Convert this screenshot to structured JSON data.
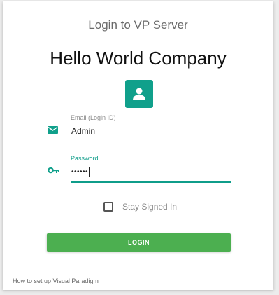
{
  "colors": {
    "accent": "#0f9d8a",
    "login_button": "#4caf50",
    "icon_teal": "#10a08b"
  },
  "header": {
    "title": "Login to VP Server",
    "company": "Hello World Company",
    "avatar_icon": "user-icon"
  },
  "form": {
    "email": {
      "label": "Email (Login ID)",
      "value": "Admin",
      "icon": "email-icon"
    },
    "password": {
      "label": "Password",
      "value": "••••••",
      "icon": "key-icon"
    },
    "stay_signed_in": {
      "label": "Stay Signed In",
      "checked": false
    },
    "login_label": "LOGIN"
  },
  "footer": {
    "help_link": "How to set up Visual Paradigm"
  }
}
